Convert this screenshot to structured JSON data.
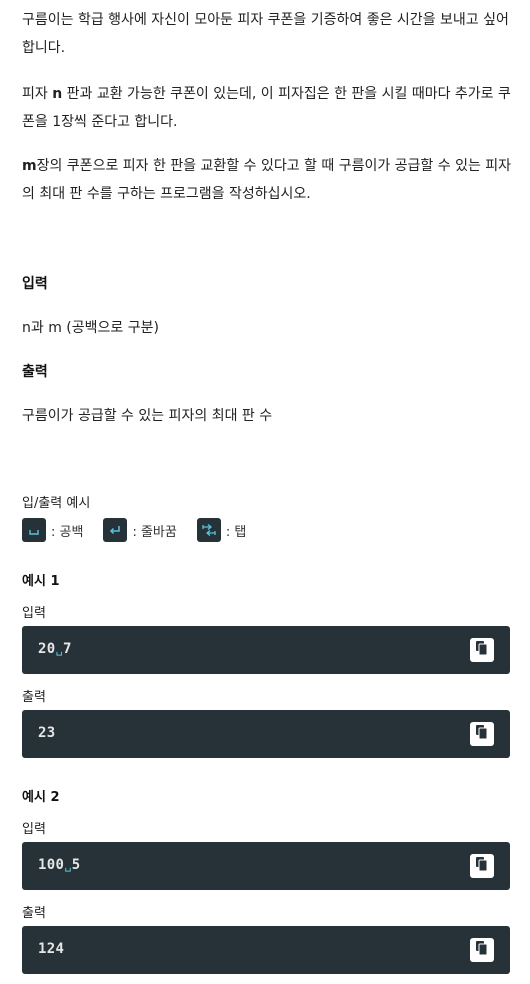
{
  "problem": {
    "p1": "구름이는 학급 행사에 자신이 모아둔 피자 쿠폰을 기증하여 좋은 시간을 보내고 싶어합니다.",
    "p2_before": "피자 ",
    "p2_bold": "n",
    "p2_after": " 판과 교환 가능한 쿠폰이 있는데, 이 피자집은 한 판을 시킬 때마다 추가로 쿠폰을 1장씩 준다고 합니다.",
    "p3_bold": "m",
    "p3_after": "장의 쿠폰으로 피자 한 판을 교환할 수 있다고 할 때 구름이가 공급할 수 있는 피자의 최대 판 수를 구하는 프로그램을 작성하십시오."
  },
  "input_section": {
    "heading": "입력",
    "text": "n과 m (공백으로 구분)"
  },
  "output_section": {
    "heading": "출력",
    "text": "구름이가 공급할 수 있는 피자의 최대 판 수"
  },
  "examples_title": "입/출력 예시",
  "legend": {
    "space_label": ": 공백",
    "newline_label": ": 줄바꿈",
    "tab_label": ": 탭"
  },
  "examples": [
    {
      "title": "예시 1",
      "input_label": "입력",
      "input_parts": [
        "20",
        "7"
      ],
      "output_label": "출력",
      "output": "23"
    },
    {
      "title": "예시 2",
      "input_label": "입력",
      "input_parts": [
        "100",
        "5"
      ],
      "output_label": "출력",
      "output": "124"
    }
  ],
  "space_glyph": "␣",
  "icons": {
    "copy": "copy-icon",
    "space": "space-icon",
    "newline": "newline-icon",
    "tab": "tab-icon"
  }
}
